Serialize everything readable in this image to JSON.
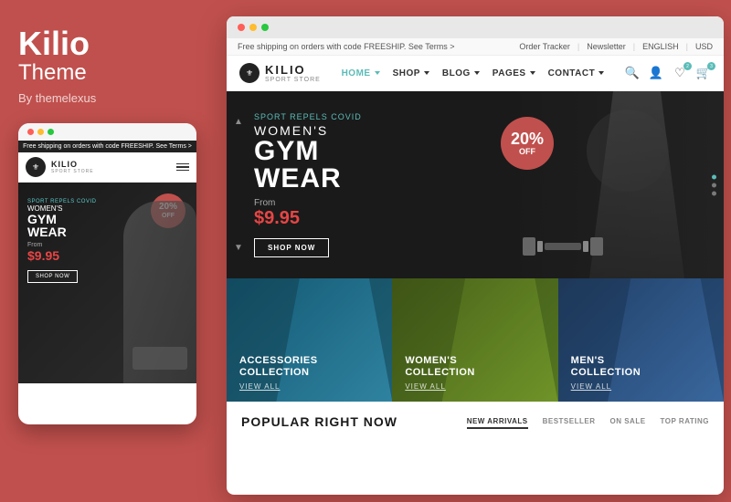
{
  "left": {
    "brand": "Kilio",
    "theme": "Theme",
    "author": "By themelexus",
    "mobile": {
      "notice": "Free shipping on orders with code FREESHIP.",
      "logo": "KILIO",
      "badge_percent": "20%",
      "badge_off": "OFF",
      "sport_text": "SPORT REPELS COVID",
      "womens": "WOMEN'S",
      "gym": "GYM",
      "wear": "WEAR",
      "from": "From",
      "price": "$9.95",
      "shop_btn": "SHOP NOW"
    }
  },
  "browser": {
    "notice": {
      "left": "Free shipping on orders with code FREESHIP. See Terms  >",
      "order_tracker": "Order Tracker",
      "newsletter": "Newsletter",
      "language": "ENGLISH",
      "currency": "USD"
    },
    "header": {
      "logo": "KILIO",
      "logo_sub": "SPORT STORE",
      "nav": [
        {
          "label": "HOME",
          "active": true,
          "has_caret": true
        },
        {
          "label": "SHOP",
          "active": false,
          "has_caret": true
        },
        {
          "label": "BLOG",
          "active": false,
          "has_caret": true
        },
        {
          "label": "PAGES",
          "active": false,
          "has_caret": true
        },
        {
          "label": "CONTACT",
          "active": false,
          "has_caret": true
        }
      ]
    },
    "hero": {
      "sport_text": "SPORT REPELS COVID",
      "womens": "WOMEN'S",
      "gym_wear": "GYM WEAR",
      "from": "From",
      "price": "$9.95",
      "shop_btn": "SHOP NOW",
      "badge_percent": "20%",
      "badge_off": "OFF"
    },
    "collections": [
      {
        "title": "ACCESSORIES\nCOLLECTION",
        "link": "VIEW ALL"
      },
      {
        "title": "WOMEN'S\nCOLLECTION",
        "link": "VIEW ALL"
      },
      {
        "title": "MEN'S\nCOLLECTION",
        "link": "VIEW ALL"
      }
    ],
    "popular": {
      "title": "POPULAR RIGHT NOW",
      "tabs": [
        {
          "label": "NEW ARRIVALS",
          "active": true
        },
        {
          "label": "BESTSELLER",
          "active": false
        },
        {
          "label": "ON SALE",
          "active": false
        },
        {
          "label": "TOP RATING",
          "active": false
        }
      ]
    }
  },
  "colors": {
    "accent": "#c0504d",
    "teal": "#5bbcb8",
    "dark": "#1a1a1a",
    "price_red": "#e84545"
  }
}
